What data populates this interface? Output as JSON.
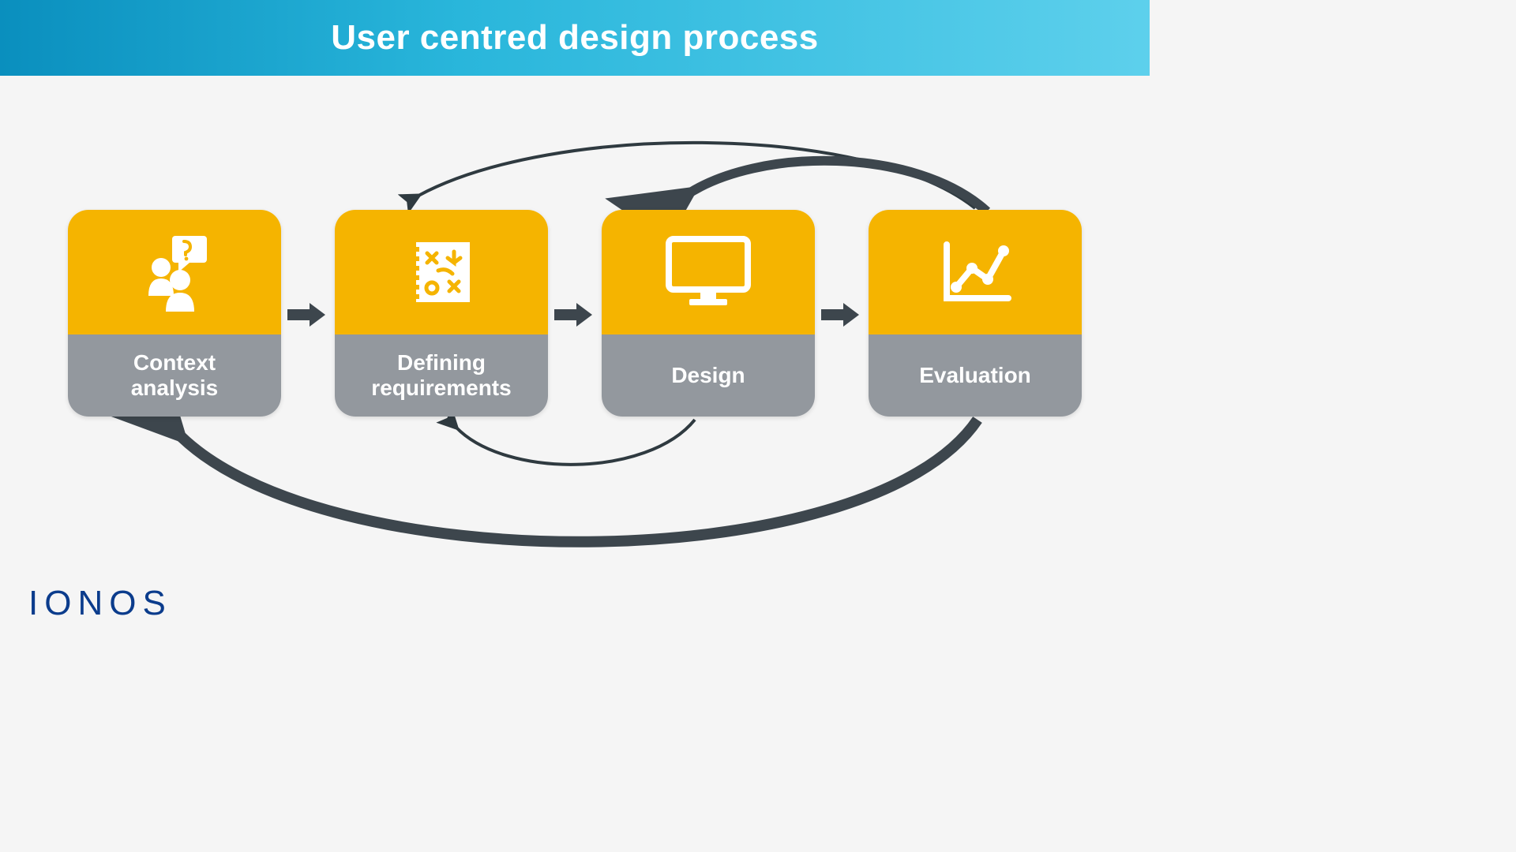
{
  "header": {
    "title": "User centred design process"
  },
  "steps": [
    {
      "label": "Context\nanalysis",
      "icon": "question-users-icon"
    },
    {
      "label": "Defining\nrequirements",
      "icon": "strategy-board-icon"
    },
    {
      "label": "Design",
      "icon": "monitor-icon"
    },
    {
      "label": "Evaluation",
      "icon": "chart-line-icon"
    }
  ],
  "feedback_arrows": [
    {
      "from": 3,
      "to": 1,
      "position": "top"
    },
    {
      "from": 3,
      "to": 2,
      "position": "top"
    },
    {
      "from": 2,
      "to": 1,
      "position": "bottom"
    },
    {
      "from": 3,
      "to": 0,
      "position": "bottom"
    }
  ],
  "brand": "IONOS",
  "colors": {
    "card_accent": "#f5b400",
    "card_label_bg": "#93989e",
    "arrow": "#3d464d",
    "header_gradient_start": "#0a8fbe",
    "header_gradient_end": "#5dd0ec",
    "brand": "#0b3c8c"
  }
}
